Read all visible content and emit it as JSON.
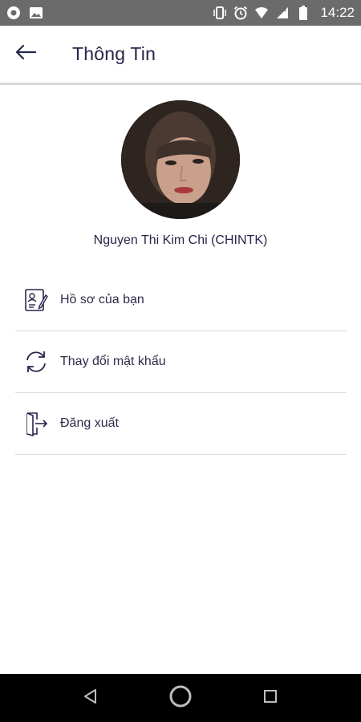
{
  "status_bar": {
    "time": "14:22",
    "left_icons": [
      "eye-icon",
      "image-icon"
    ],
    "right_icons": [
      "vibrate-icon",
      "alarm-icon",
      "wifi-icon",
      "no-signal-icon",
      "battery-icon"
    ]
  },
  "header": {
    "title": "Thông Tin",
    "back_icon": "arrow-left-icon"
  },
  "profile": {
    "name": "Nguyen Thi Kim Chi (CHINTK)"
  },
  "menu": {
    "items": [
      {
        "label": "Hồ sơ của bạn",
        "icon": "profile-document-icon"
      },
      {
        "label": "Thay đổi mật khẩu",
        "icon": "refresh-icon"
      },
      {
        "label": "Đăng xuất",
        "icon": "logout-icon"
      }
    ]
  },
  "nav_bar": {
    "buttons": [
      "back-triangle-icon",
      "home-circle-icon",
      "recents-square-icon"
    ]
  },
  "colors": {
    "status_bar": "#6b6b6b",
    "text_primary": "#25254a",
    "divider": "#dcdcdc",
    "nav_bar": "#000000"
  }
}
